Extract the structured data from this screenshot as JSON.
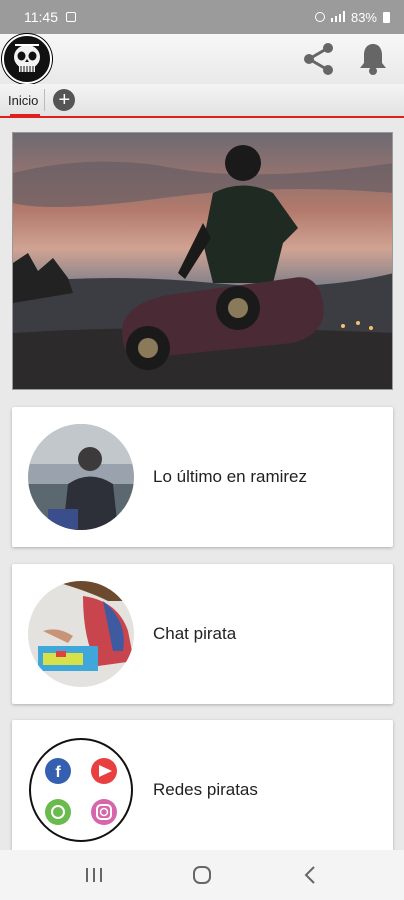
{
  "status_bar": {
    "time": "11:45",
    "battery": "83%"
  },
  "app_bar": {
    "logo_icon": "skull-logo",
    "share_icon": "share-icon",
    "bell_icon": "bell-icon"
  },
  "tabs": [
    {
      "label": "Inicio",
      "active": true
    }
  ],
  "add_tab_symbol": "+",
  "hero": {
    "description_icon": "hero-photo"
  },
  "cards": [
    {
      "label": "Lo último en ramirez",
      "avatar_icon": "child-photo-avatar"
    },
    {
      "label": "Chat pirata",
      "avatar_icon": "child-painting-avatar"
    },
    {
      "label": "Redes piratas",
      "avatar_icon": "social-networks-avatar"
    }
  ],
  "colors": {
    "accent": "#e01e1e",
    "status_bar": "#9b9b9b",
    "icons": "#555555"
  }
}
